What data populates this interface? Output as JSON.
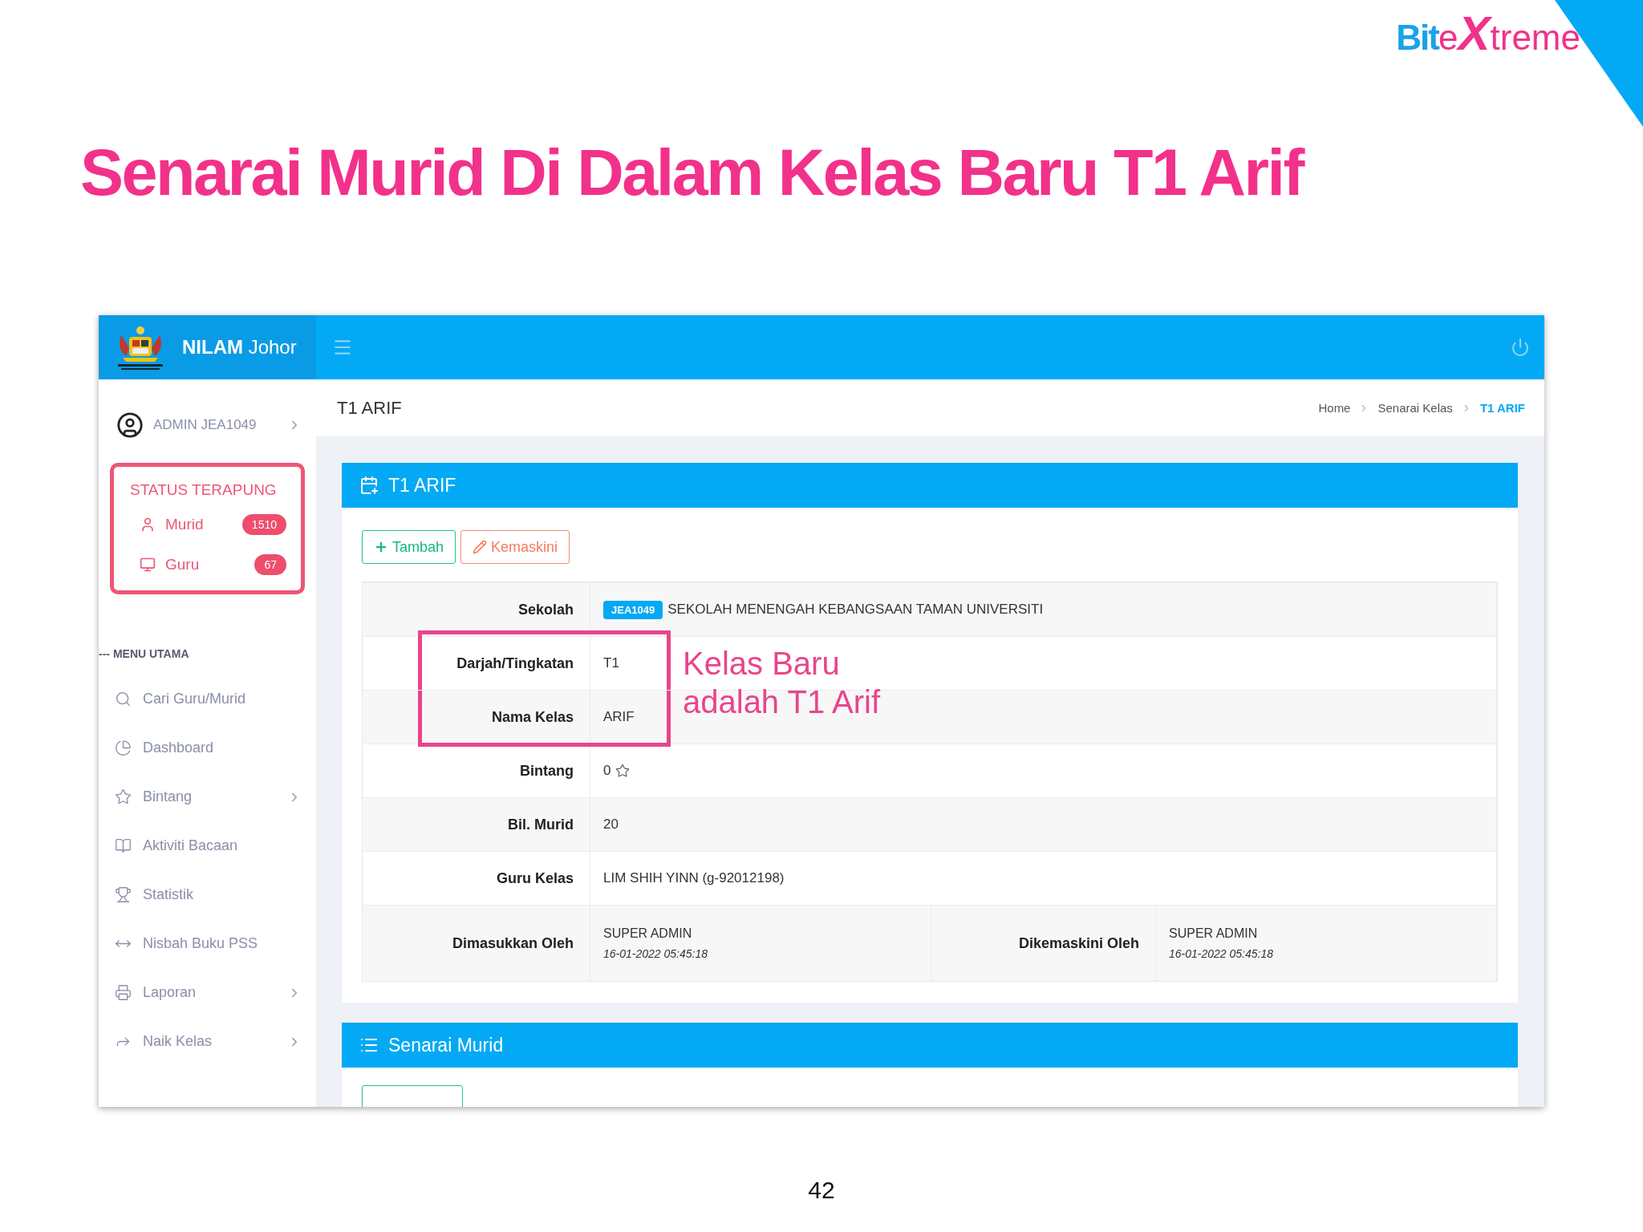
{
  "logo": [
    {
      "text": "Bit",
      "kind": "heavy"
    },
    {
      "text": "e",
      "kind": "light"
    },
    {
      "text": "X",
      "kind": "big"
    },
    {
      "text": "treme",
      "kind": "light"
    }
  ],
  "slide_title": "Senarai Murid Di Dalam Kelas Baru T1 Arif",
  "app": {
    "brand": {
      "bold": "NILAM",
      "light": "Johor"
    },
    "user": "ADMIN JEA1049",
    "status_panel": {
      "title": "STATUS TERAPUNG",
      "items": [
        {
          "label": "Murid",
          "count": "1510"
        },
        {
          "label": "Guru",
          "count": "67"
        }
      ]
    },
    "menu_heading": "--- MENU UTAMA",
    "menu": [
      {
        "label": "Cari Guru/Murid",
        "expandable": false
      },
      {
        "label": "Dashboard",
        "expandable": false
      },
      {
        "label": "Bintang",
        "expandable": true
      },
      {
        "label": "Aktiviti Bacaan",
        "expandable": false
      },
      {
        "label": "Statistik",
        "expandable": false
      },
      {
        "label": "Nisbah Buku PSS",
        "expandable": false
      },
      {
        "label": "Laporan",
        "expandable": true
      },
      {
        "label": "Naik Kelas",
        "expandable": true
      }
    ],
    "page_title": "T1 ARIF",
    "breadcrumb": [
      {
        "label": "Home",
        "selected": false
      },
      {
        "label": "Senarai Kelas",
        "selected": false
      },
      {
        "label": "T1 ARIF",
        "selected": true
      }
    ],
    "card": {
      "title": "T1 ARIF",
      "buttons": [
        {
          "label": "Tambah",
          "kind": "add"
        },
        {
          "label": "Kemaskini",
          "kind": "edit"
        }
      ],
      "rows": [
        {
          "kind": "school",
          "label": "Sekolah",
          "badge": "JEA1049",
          "value": "SEKOLAH MENENGAH KEBANGSAAN TAMAN UNIVERSITI",
          "highlighted": false
        },
        {
          "kind": "text",
          "label": "Darjah/Tingkatan",
          "value": "T1",
          "highlighted": true
        },
        {
          "kind": "text",
          "label": "Nama Kelas",
          "value": "ARIF",
          "highlighted": true
        },
        {
          "kind": "stars",
          "label": "Bintang",
          "value": "0",
          "highlighted": false
        },
        {
          "kind": "text",
          "label": "Bil. Murid",
          "value": "20",
          "highlighted": false
        },
        {
          "kind": "text",
          "label": "Guru Kelas",
          "value": "LIM SHIH YINN (g-92012198)",
          "highlighted": false
        },
        {
          "kind": "audit",
          "highlighted": false,
          "cells": [
            {
              "label": "Dimasukkan Oleh",
              "name": "SUPER ADMIN",
              "time": "16-01-2022 05:45:18"
            },
            {
              "label": "Dikemaskini Oleh",
              "name": "SUPER ADMIN",
              "time": "16-01-2022 05:45:18"
            }
          ]
        }
      ]
    },
    "annotation": [
      "Kelas Baru",
      "adalah T1 Arif"
    ],
    "second_card": {
      "title": "Senarai Murid"
    }
  },
  "page_number": "42"
}
